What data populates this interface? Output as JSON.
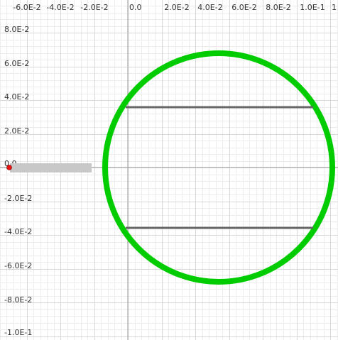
{
  "graphics_view": {
    "x_axis_labels": [
      "-6.0E-2",
      "-4.0E-2",
      "-2.0E-2",
      "0.0",
      "2.0E-2",
      "4.0E-2",
      "6.0E-2",
      "8.0E-2",
      "1.0E-1",
      "1"
    ],
    "y_axis_labels": [
      "8.0E-2",
      "6.0E-2",
      "4.0E-2",
      "2.0E-2",
      "0.0",
      "-2.0E-2",
      "-4.0E-2",
      "-6.0E-2",
      "-8.0E-2",
      "-1.0E-1"
    ],
    "colors": {
      "circle": "#00cc00",
      "segments": "#666666",
      "slider_track": "#c8c8c8",
      "slider_point": "#ee1111",
      "grid_minor": "#ececec",
      "grid_major": "#d8d8d8",
      "axis": "#999999"
    }
  }
}
